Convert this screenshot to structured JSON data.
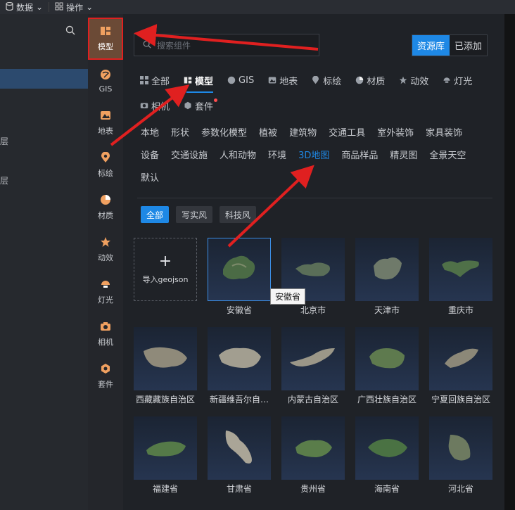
{
  "topbar": {
    "menu1": "数据",
    "menu2": "操作"
  },
  "left_panel": {
    "row1": "层",
    "row2": "层"
  },
  "sidebar": {
    "items": [
      {
        "label": "模型",
        "icon": "model-icon",
        "color": "#f0a060"
      },
      {
        "label": "GIS",
        "icon": "gis-icon",
        "color": "#f0a060"
      },
      {
        "label": "地表",
        "icon": "terrain-icon",
        "color": "#f0a060"
      },
      {
        "label": "标绘",
        "icon": "marker-icon",
        "color": "#f0a060"
      },
      {
        "label": "材质",
        "icon": "material-icon",
        "color": "#f0a060"
      },
      {
        "label": "动效",
        "icon": "effect-icon",
        "color": "#f0a060"
      },
      {
        "label": "灯光",
        "icon": "light-icon",
        "color": "#f0a060"
      },
      {
        "label": "相机",
        "icon": "camera-icon",
        "color": "#f0a060"
      },
      {
        "label": "套件",
        "icon": "kit-icon",
        "color": "#f0a060"
      }
    ]
  },
  "search": {
    "placeholder": "搜索组件"
  },
  "source_toggle": {
    "library": "资源库",
    "added": "已添加"
  },
  "type_tabs": [
    "全部",
    "模型",
    "GIS",
    "地表",
    "标绘",
    "材质",
    "动效",
    "灯光",
    "相机",
    "套件"
  ],
  "categories": [
    "本地",
    "形状",
    "参数化模型",
    "植被",
    "建筑物",
    "交通工具",
    "室外装饰",
    "家具装饰",
    "设备",
    "交通设施",
    "人和动物",
    "环境",
    "3D地图",
    "商品样品",
    "精灵图",
    "全景天空",
    "默认"
  ],
  "styles": [
    "全部",
    "写实风",
    "科技风"
  ],
  "import_label": "导入geojson",
  "tooltip": "安徽省",
  "assets": [
    "安徽省",
    "北京市",
    "天津市",
    "重庆市",
    "西藏藏族自治区",
    "新疆维吾尔自…",
    "内蒙古自治区",
    "广西壮族自治区",
    "宁夏回族自治区",
    "福建省",
    "甘肃省",
    "贵州省",
    "海南省",
    "河北省"
  ],
  "colors": {
    "accent": "#1e88e5",
    "annotation": "#e02020",
    "active_sidebar": "#6b4a36"
  }
}
